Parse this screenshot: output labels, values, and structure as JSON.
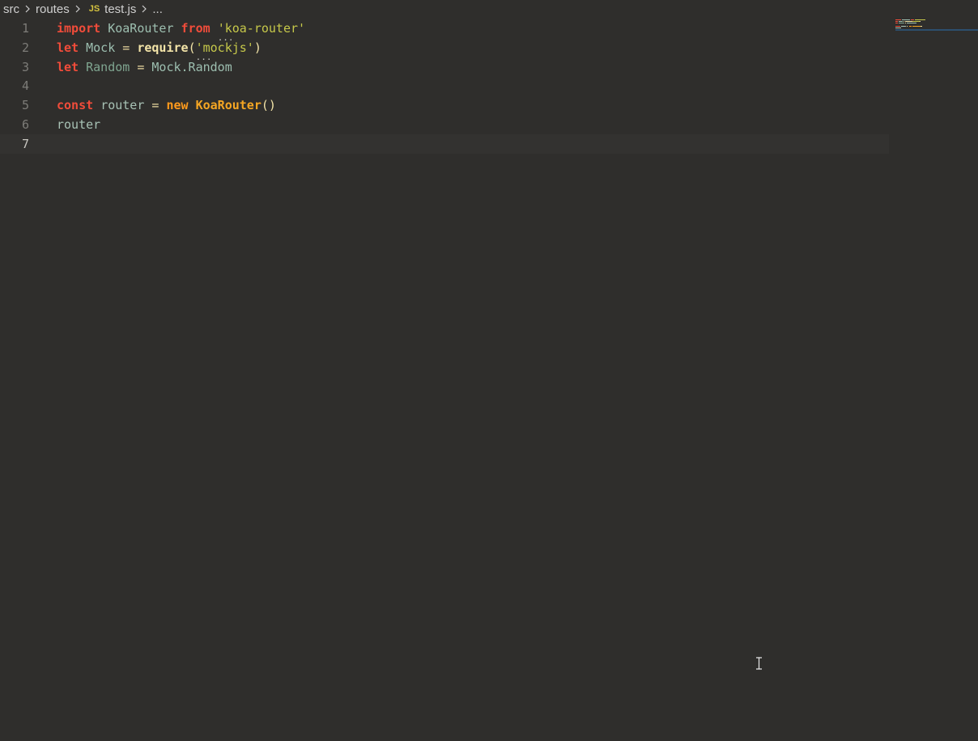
{
  "breadcrumb": {
    "items": [
      "src",
      "routes"
    ],
    "file_type_badge": "JS",
    "file": "test.js",
    "more": "..."
  },
  "editor": {
    "lines": [
      {
        "number": "1",
        "tokens": [
          {
            "t": "import",
            "c": "kw"
          },
          {
            "t": " ",
            "c": ""
          },
          {
            "t": "KoaRouter",
            "c": "cls"
          },
          {
            "t": " ",
            "c": ""
          },
          {
            "t": "from",
            "c": "kw"
          },
          {
            "t": " ",
            "c": ""
          },
          {
            "t": "'",
            "c": "str hint-dots"
          },
          {
            "t": "koa-router'",
            "c": "str"
          }
        ]
      },
      {
        "number": "2",
        "tokens": [
          {
            "t": "let",
            "c": "kw"
          },
          {
            "t": " ",
            "c": ""
          },
          {
            "t": "Mock",
            "c": "cls"
          },
          {
            "t": " ",
            "c": ""
          },
          {
            "t": "=",
            "c": "op"
          },
          {
            "t": " ",
            "c": ""
          },
          {
            "t": "require",
            "c": "fn"
          },
          {
            "t": "(",
            "c": "punc"
          },
          {
            "t": "'",
            "c": "str hint-dots"
          },
          {
            "t": "mockjs'",
            "c": "str"
          },
          {
            "t": ")",
            "c": "punc"
          }
        ]
      },
      {
        "number": "3",
        "tokens": [
          {
            "t": "let",
            "c": "kw"
          },
          {
            "t": " ",
            "c": ""
          },
          {
            "t": "Random",
            "c": "var"
          },
          {
            "t": " ",
            "c": ""
          },
          {
            "t": "=",
            "c": "op"
          },
          {
            "t": " ",
            "c": ""
          },
          {
            "t": "Mock.Random",
            "c": "cls"
          }
        ]
      },
      {
        "number": "4",
        "tokens": []
      },
      {
        "number": "5",
        "tokens": [
          {
            "t": "const",
            "c": "kw"
          },
          {
            "t": " ",
            "c": ""
          },
          {
            "t": "router",
            "c": "ident"
          },
          {
            "t": " ",
            "c": ""
          },
          {
            "t": "=",
            "c": "op"
          },
          {
            "t": " ",
            "c": ""
          },
          {
            "t": "new",
            "c": "new"
          },
          {
            "t": " ",
            "c": ""
          },
          {
            "t": "KoaRouter",
            "c": "ctor"
          },
          {
            "t": "()",
            "c": "punc"
          }
        ]
      },
      {
        "number": "6",
        "tokens": [
          {
            "t": "router",
            "c": "ident"
          }
        ]
      },
      {
        "number": "7",
        "tokens": []
      }
    ],
    "current_line": "7"
  },
  "colors": {
    "background": "#2f2e2c",
    "keyword": "#f14c3a",
    "string": "#c6c84a",
    "class": "#9dbfb0",
    "function": "#f3e4a8",
    "new_keyword": "#ff9a1c"
  },
  "icons": {
    "breadcrumb_separator": "chevron-right-icon",
    "file_type": "javascript-file-icon",
    "mouse_cursor": "text-cursor-icon"
  }
}
